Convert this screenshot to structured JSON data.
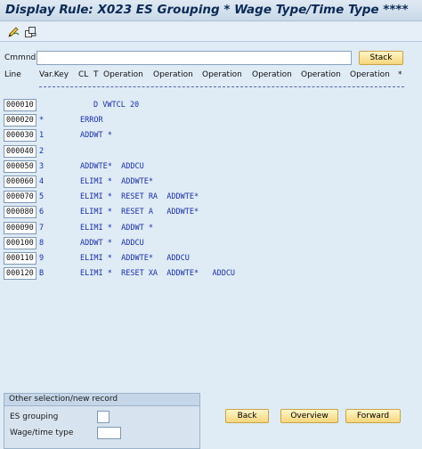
{
  "window": {
    "title": "Display Rule: X023 ES Grouping * Wage Type/Time Type ****"
  },
  "toolbar": {
    "icons": [
      "edit-pencil-icon",
      "change-display-icon"
    ]
  },
  "command": {
    "label": "Cmmnd",
    "value": "",
    "stack_label": "Stack"
  },
  "header": {
    "line": "Line",
    "varkey": "Var.Key",
    "cl": "CL",
    "t": "T",
    "operations": [
      "Operation",
      "Operation",
      "Operation",
      "Operation",
      "Operation",
      "Operation",
      "*"
    ]
  },
  "rows": [
    {
      "line": "000010",
      "text": "D VWTCL 20"
    },
    {
      "line": "000020",
      "text": "*        ERROR"
    },
    {
      "line": "000030",
      "text": "1        ADDWT *"
    },
    {
      "line": "000040",
      "text": "2"
    },
    {
      "line": "000050",
      "text": "3        ADDWTE*  ADDCU"
    },
    {
      "line": "000060",
      "text": "4        ELIMI *  ADDWTE*"
    },
    {
      "line": "000070",
      "text": "5        ELIMI *  RESET RA  ADDWTE*"
    },
    {
      "line": "000080",
      "text": "6        ELIMI *  RESET A   ADDWTE*"
    },
    {
      "line": "000090",
      "text": "7        ELIMI *  ADDWT *"
    },
    {
      "line": "000100",
      "text": "8        ADDWT *  ADDCU"
    },
    {
      "line": "000110",
      "text": "9        ELIMI *  ADDWTE*   ADDCU"
    },
    {
      "line": "000120",
      "text": "B        ELIMI *  RESET XA  ADDWTE*   ADDCU"
    }
  ],
  "selection": {
    "title": "Other selection/new record",
    "es_grouping_label": "ES grouping",
    "es_grouping_value": "",
    "wage_type_label": "Wage/time type",
    "wage_type_value": ""
  },
  "nav": {
    "back": "Back",
    "overview": "Overview",
    "forward": "Forward"
  }
}
